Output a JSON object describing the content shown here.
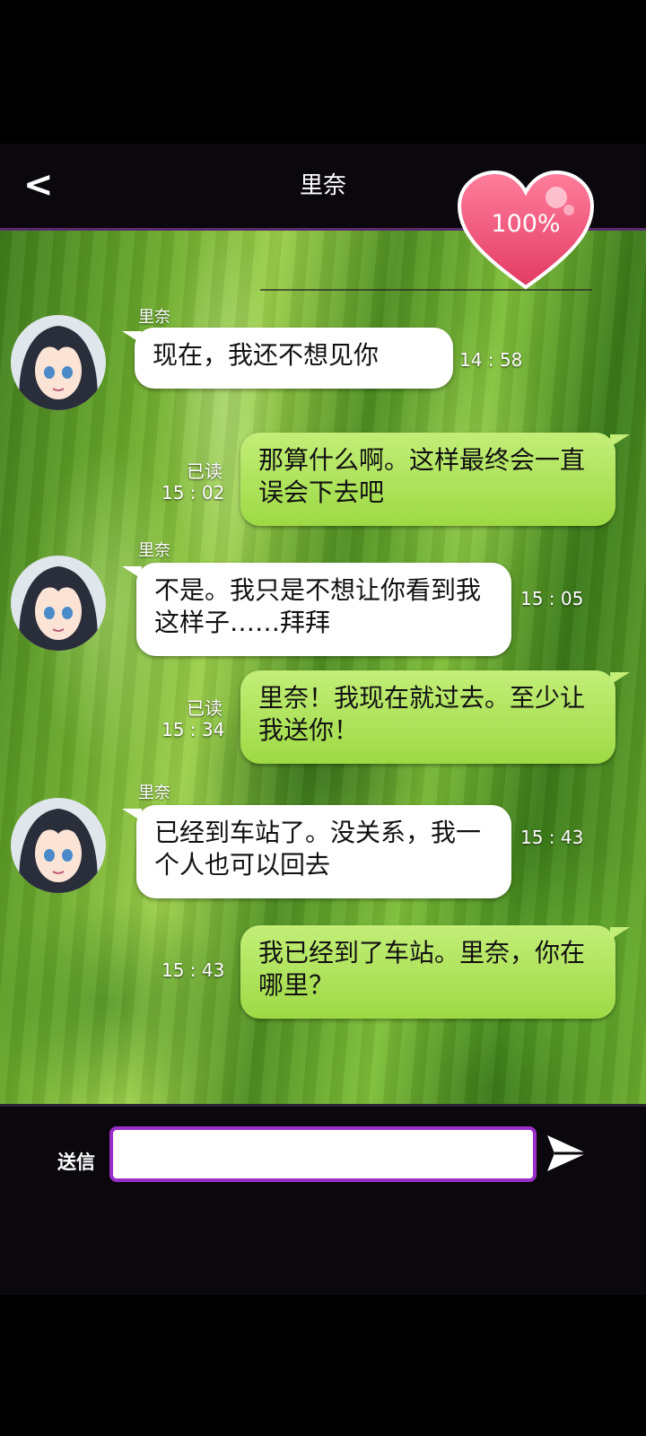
{
  "header": {
    "back_label": "<",
    "title": "里奈",
    "affection": "100%"
  },
  "messages": [
    {
      "side": "left",
      "sender": "里奈",
      "text": "现在，我还不想见你",
      "time": "14 : 58"
    },
    {
      "side": "right",
      "read": "已读",
      "text": "那算什么啊。这样最终会一直误会下去吧",
      "time": "15 : 02"
    },
    {
      "side": "left",
      "sender": "里奈",
      "text": "不是。我只是不想让你看到我这样子……拜拜",
      "time": "15 : 05"
    },
    {
      "side": "right",
      "read": "已读",
      "text": "里奈！我现在就过去。至少让我送你！",
      "time": "15 : 34"
    },
    {
      "side": "left",
      "sender": "里奈",
      "text": "已经到车站了。没关系，我一个人也可以回去",
      "time": "15 : 43"
    },
    {
      "side": "right",
      "read": "",
      "text": "我已经到了车站。里奈，你在哪里？",
      "time": "15 : 43"
    }
  ],
  "composer": {
    "send_label": "送信",
    "input_value": "",
    "send_icon": "send-icon"
  },
  "colors": {
    "accent": "#9b2ec8",
    "heart": "#f2557a",
    "bubble_right": "#a8df4e",
    "bubble_left": "#ffffff",
    "bar": "#0b080d"
  }
}
